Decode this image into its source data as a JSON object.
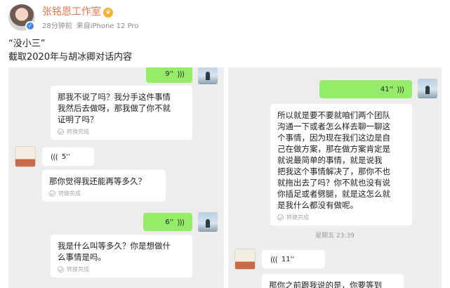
{
  "post": {
    "author": "张铭恩工作室",
    "time_ago": "28分钟前",
    "source": "来自iPhone 12 Pro",
    "caption_line1": "“没小三”",
    "caption_line2": "截取2020年与胡冰卿对话内容"
  },
  "icons": {
    "vip": "vip-badge-icon",
    "verified": "verified-badge-icon",
    "voice": "voice-wave-icon",
    "transcribe_check": "check-circle-icon"
  },
  "colors": {
    "author_name": "#eb7350",
    "outgoing_bubble": "#95ec69",
    "chat_background": "#ededed"
  },
  "left_chat": {
    "voice_out_1": "9''",
    "transcript_1": "那我不说了吗？我分手这件事情\n我然后去做呀，那我做了你不就\n证明了吗？",
    "transcript_1_status": "转换完成",
    "voice_in_1": "5''",
    "transcript_2": "那你觉得我还能再等多久？",
    "transcript_2_status": "转换完成",
    "voice_out_2": "6''",
    "transcript_3": "我是什么叫等多久？你是想做什\n么事情是吗。",
    "transcript_3_status": "转换完成"
  },
  "right_chat": {
    "voice_out_1": "41''",
    "transcript_1": "所以就是要不要就咱们两个团队\n沟通一下或者怎么样去聊一聊这\n个事情，因为现在我们这边是自\n己在做方案，那在做方案肯定是\n就说最简单的事情，就是说我\n把我这个事情解决了，那你不也\n就拖出去了吗？你不就也没有说\n你插足或者劈腿，就是这怎么就\n是我什么都没有做呢。",
    "transcript_1_status": "转换完成",
    "timestamp": "星期五 23:39",
    "voice_in_1": "11''",
    "transcript_2": "那你之前跟我说的是，你要等到"
  }
}
